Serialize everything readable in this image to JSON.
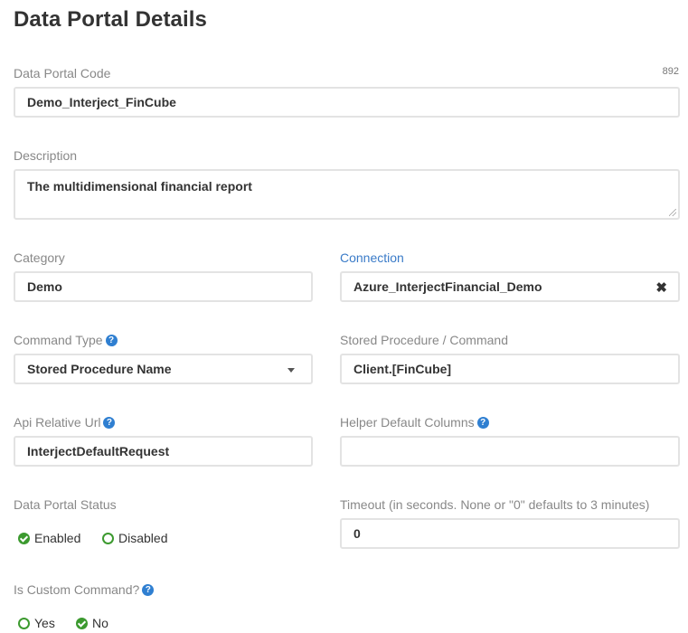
{
  "page": {
    "title": "Data Portal Details"
  },
  "code": {
    "label": "Data Portal Code",
    "counter": "892",
    "value": "Demo_Interject_FinCube"
  },
  "description": {
    "label": "Description",
    "value": "The multidimensional financial report"
  },
  "category": {
    "label": "Category",
    "value": "Demo"
  },
  "connection": {
    "label": "Connection",
    "value": "Azure_InterjectFinancial_Demo",
    "clear_icon": "✖"
  },
  "command_type": {
    "label": "Command Type",
    "value": "Stored Procedure Name"
  },
  "stored_procedure": {
    "label": "Stored Procedure / Command",
    "value": "Client.[FinCube]"
  },
  "api_url": {
    "label": "Api Relative Url",
    "value": "InterjectDefaultRequest"
  },
  "helper_columns": {
    "label": "Helper Default Columns",
    "value": ""
  },
  "status": {
    "label": "Data Portal Status",
    "options": [
      "Enabled",
      "Disabled"
    ],
    "selected": "Enabled"
  },
  "timeout": {
    "label": "Timeout (in seconds. None or \"0\" defaults to 3 minutes)",
    "value": "0"
  },
  "custom_command": {
    "label": "Is Custom Command?",
    "options": [
      "Yes",
      "No"
    ],
    "selected": "No"
  },
  "icons": {
    "help": "question-circle-icon",
    "help_glyph": "?"
  },
  "colors": {
    "accent_blue": "#2f7fd1",
    "success_green": "#3c9a2f",
    "label_gray": "#888888"
  }
}
